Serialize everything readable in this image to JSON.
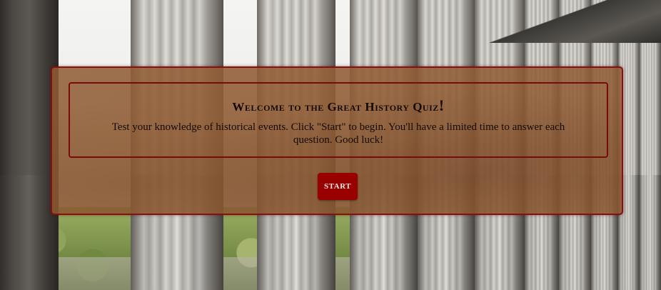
{
  "quiz": {
    "title_main": "Welcome to the Great History Quiz",
    "title_mark": "!",
    "description": "Test your knowledge of historical events. Click \"Start\" to begin. You'll have a limited time to answer each question. Good luck!",
    "start_label": "START"
  },
  "colors": {
    "accent": "#990000",
    "panel": "#8f5c34",
    "border": "#8b0d0d"
  },
  "background": {
    "scene": "colonnade-photo"
  }
}
